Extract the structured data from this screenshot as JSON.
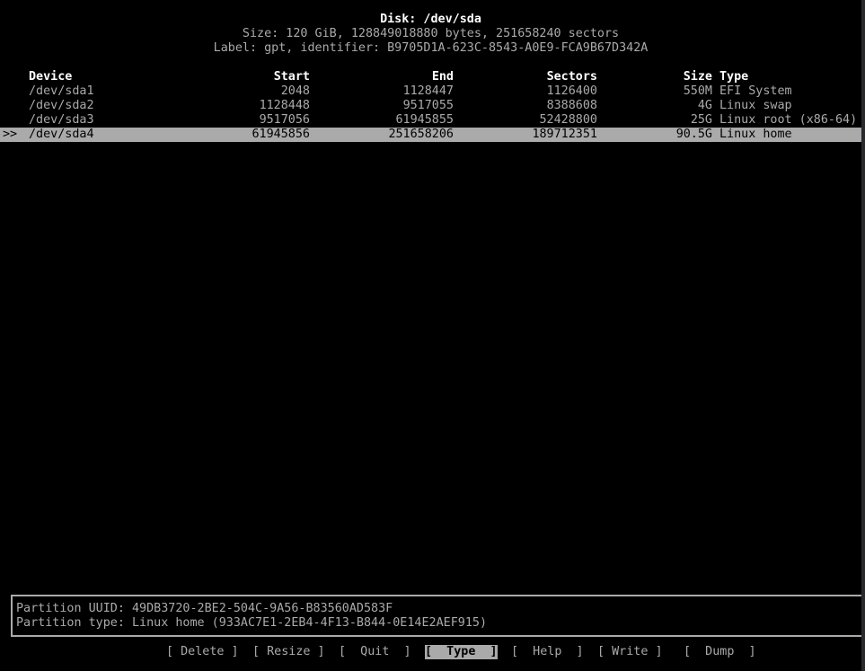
{
  "disk": {
    "title": "Disk: /dev/sda",
    "size_line": "Size: 120 GiB, 128849018880 bytes, 251658240 sectors",
    "label_line": "Label: gpt, identifier: B9705D1A-623C-8543-A0E9-FCA9B67D342A"
  },
  "table": {
    "columns": [
      "Device",
      "Start",
      "End",
      "Sectors",
      "Size",
      "Type"
    ],
    "selection_marker": ">>",
    "rows": [
      {
        "device": "/dev/sda1",
        "start": "2048",
        "end": "1128447",
        "sectors": "1126400",
        "size": "550M",
        "type": "EFI System"
      },
      {
        "device": "/dev/sda2",
        "start": "1128448",
        "end": "9517055",
        "sectors": "8388608",
        "size": "4G",
        "type": "Linux swap"
      },
      {
        "device": "/dev/sda3",
        "start": "9517056",
        "end": "61945855",
        "sectors": "52428800",
        "size": "25G",
        "type": "Linux root (x86-64)"
      },
      {
        "device": "/dev/sda4",
        "start": "61945856",
        "end": "251658206",
        "sectors": "189712351",
        "size": "90.5G",
        "type": "Linux home"
      }
    ],
    "selected_index": 3
  },
  "info": {
    "uuid_line": "Partition UUID: 49DB3720-2BE2-504C-9A56-B83560AD583F",
    "type_line": "Partition type: Linux home (933AC7E1-2EB4-4F13-B844-0E14E2AEF915)"
  },
  "menu": {
    "delete": "[ Delete ]",
    "resize": "[ Resize ]",
    "quit": "[  Quit  ]",
    "type": "[  Type  ]",
    "help": "[  Help  ]",
    "write": "[ Write ]",
    "dump": "[  Dump  ]",
    "active": "type"
  }
}
